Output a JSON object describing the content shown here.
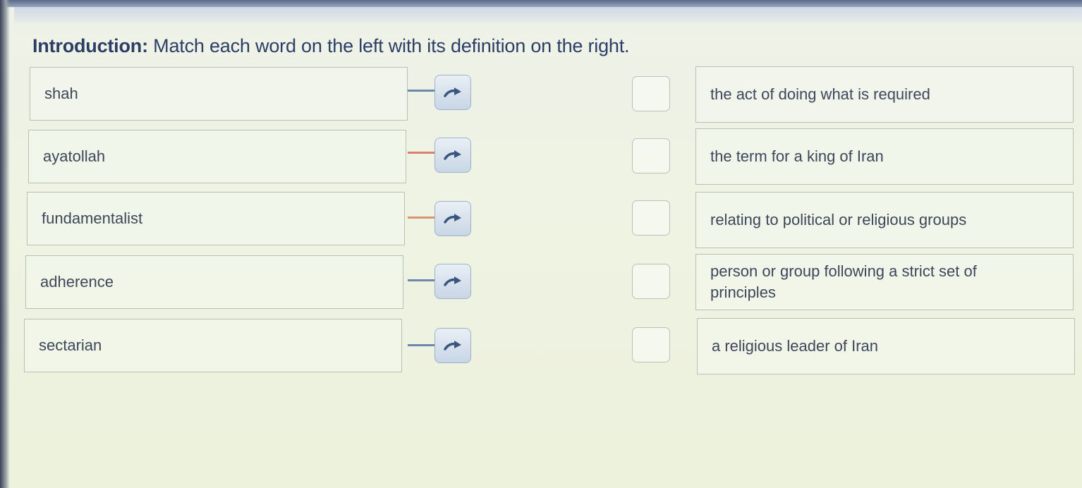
{
  "intro": {
    "label": "Introduction:",
    "text": " Match each word on the left with its definition on the right."
  },
  "words": [
    {
      "label": "shah",
      "connector_color": "#6d88ad"
    },
    {
      "label": "ayatollah",
      "connector_color": "#d9816f"
    },
    {
      "label": "fundamentalist",
      "connector_color": "#d9966f"
    },
    {
      "label": "adherence",
      "connector_color": "#6d88ad"
    },
    {
      "label": "sectarian",
      "connector_color": "#6d88ad"
    }
  ],
  "definitions": [
    {
      "label": "the act of doing what is required"
    },
    {
      "label": "the term for a king of Iran"
    },
    {
      "label": "relating to political or religious groups"
    },
    {
      "label": "person or group following a strict set of principles"
    },
    {
      "label": "a religious leader of Iran"
    }
  ],
  "icons": {
    "arrow_button": "curved-arrow-right-icon"
  },
  "colors": {
    "title": "#2c3e66",
    "text": "#3e4759",
    "border": "#b8c0b2",
    "button_border": "#9fb1c8",
    "arrow": "#3a5680"
  }
}
